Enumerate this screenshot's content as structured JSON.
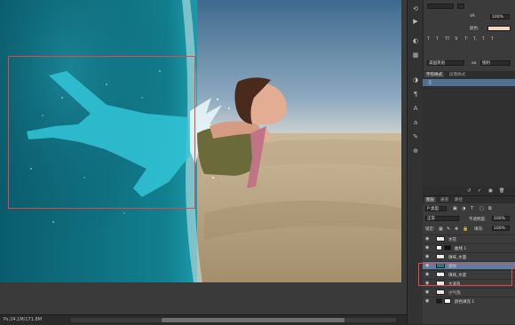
{
  "status": {
    "doc_size": "Ps:24.1M/171.8M"
  },
  "colors": {
    "accent_selection": "#5c7fa6",
    "highlight_frame": "#e84545",
    "water": "#0e6f80",
    "sand": "#b9a583"
  },
  "properties_panel": {
    "opacity_value": "100%",
    "color_label": "颜色:",
    "text_style_icons": [
      "T",
      "T",
      "TT",
      "Tr",
      "T'",
      "T,",
      "T",
      "T"
    ],
    "aa_label": "aa",
    "aa_mode": "锐利",
    "lang_value": "美国英语"
  },
  "styles_panel": {
    "tabs": [
      "字符样式",
      "段落样式"
    ],
    "item": "正"
  },
  "layers_panel": {
    "tabs": [
      "图层",
      "通道",
      "路径"
    ],
    "filter_label": "P 类型",
    "blend_mode": "正常",
    "opacity_label": "不透明度:",
    "opacity_value": "100%",
    "lock_label": "锁定:",
    "fill_label": "填充:",
    "fill_value": "100%",
    "layers": [
      {
        "name": "水花"
      },
      {
        "name": "曲线 1"
      },
      {
        "name": "填抹_水面"
      },
      {
        "name": "波纹"
      },
      {
        "name": "填抹_水底"
      },
      {
        "name": "大波浪"
      },
      {
        "name": "小气泡"
      },
      {
        "name": "颜色填充 1"
      }
    ]
  },
  "tool_strip": {
    "icons": [
      "history-icon",
      "actions-icon",
      "color-icon",
      "swatches-icon",
      "adjust-icon",
      "paragraph-icon",
      "character-icon",
      "glyph-icon",
      "brush-icon",
      "clone-icon"
    ]
  }
}
